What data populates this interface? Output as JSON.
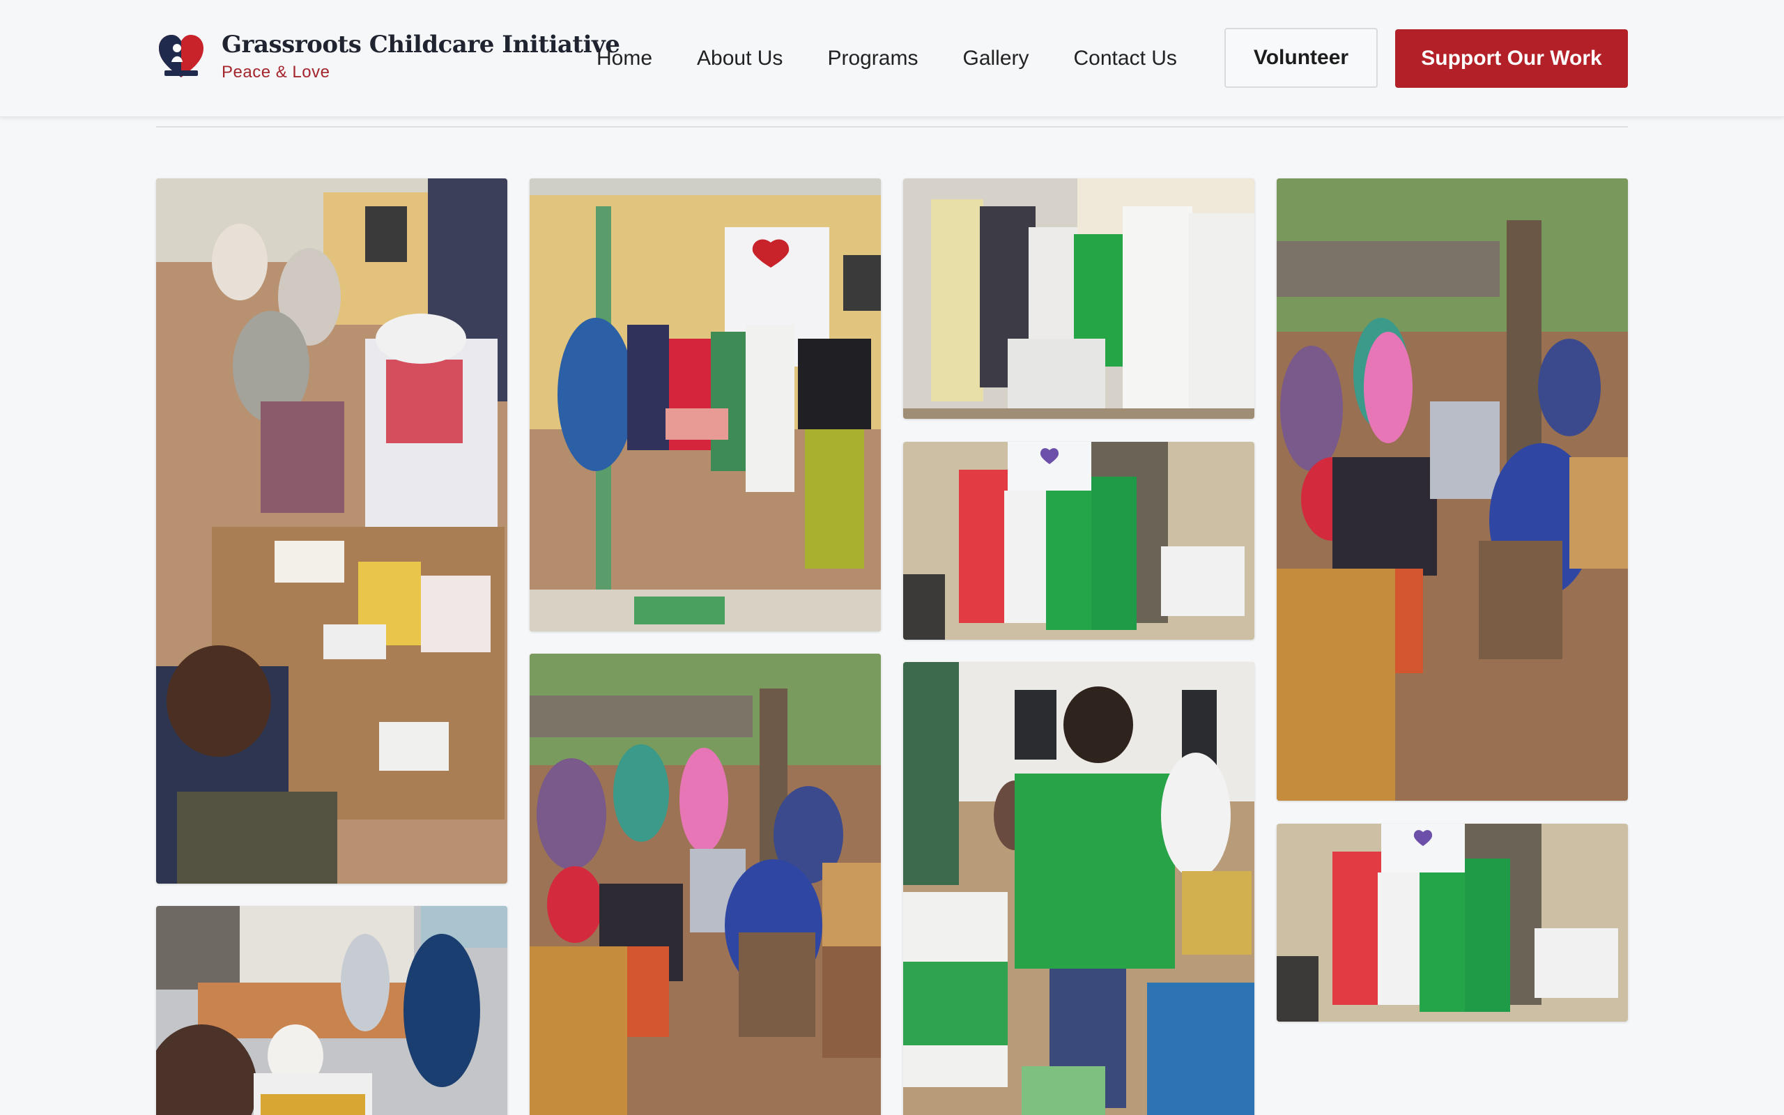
{
  "brand": {
    "name": "Grassroots Childcare Initiative",
    "tagline": "Peace & Love"
  },
  "nav": {
    "items": [
      {
        "label": "Home"
      },
      {
        "label": "About Us"
      },
      {
        "label": "Programs"
      },
      {
        "label": "Gallery"
      },
      {
        "label": "Contact Us"
      }
    ]
  },
  "actions": {
    "volunteer_label": "Volunteer",
    "support_label": "Support Our Work"
  },
  "colors": {
    "accent": "#b32027",
    "background": "#f6f7f9"
  },
  "gallery": {
    "photos": [
      {
        "subject": "medical outreach with medicine table"
      },
      {
        "subject": "white cane presentation to pupils"
      },
      {
        "subject": "group photo with green shirts"
      },
      {
        "subject": "team in front of banner"
      },
      {
        "subject": "crowd seated under trees"
      },
      {
        "subject": "health screening of woman"
      },
      {
        "subject": "crowd seated under trees"
      },
      {
        "subject": "volunteer in green shirt at outreach"
      },
      {
        "subject": "team in front of banner"
      }
    ]
  }
}
